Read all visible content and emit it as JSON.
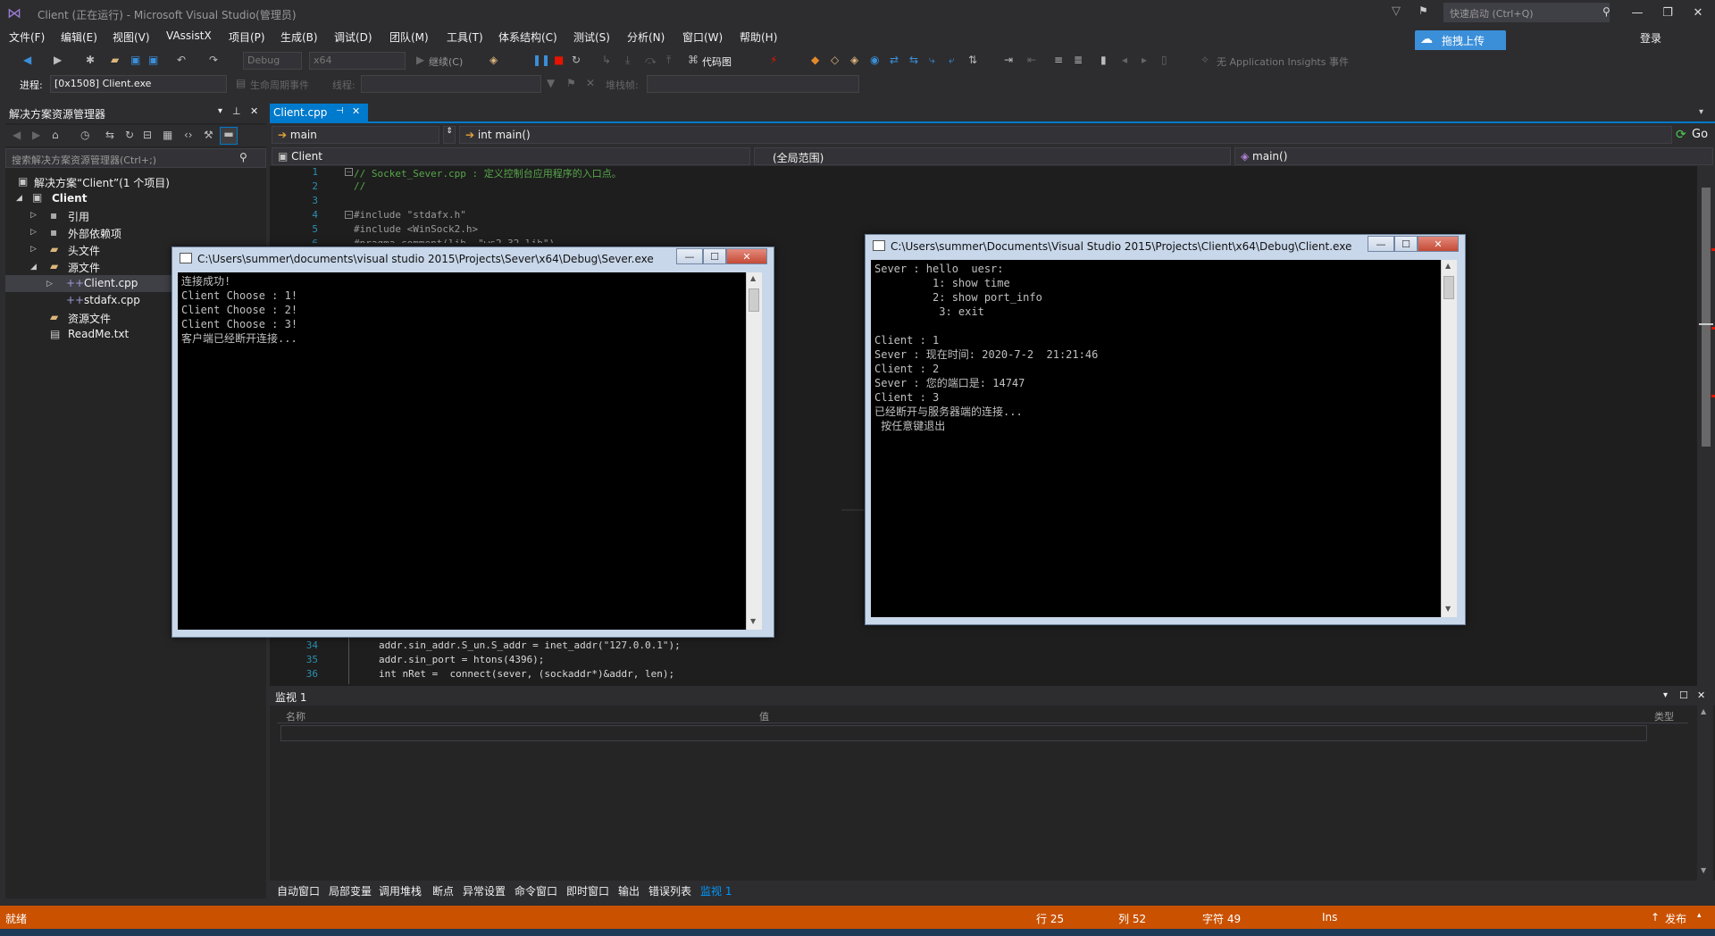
{
  "window": {
    "title": "Client (正在运行) - Microsoft Visual Studio(管理员)",
    "quick_launch_placeholder": "快速启动 (Ctrl+Q)"
  },
  "menu": [
    "文件(F)",
    "编辑(E)",
    "视图(V)",
    "VAssistX",
    "项目(P)",
    "生成(B)",
    "调试(D)",
    "团队(M)",
    "工具(T)",
    "体系结构(C)",
    "测试(S)",
    "分析(N)",
    "窗口(W)",
    "帮助(H)"
  ],
  "upload_button": "拖拽上传",
  "login": "登录",
  "toolbar": {
    "config": "Debug",
    "platform": "x64",
    "continue": "继续(C)",
    "code_map": "代码图",
    "app_insights": "无 Application Insights 事件",
    "process_label": "进程:",
    "process_value": "[0x1508] Client.exe",
    "lifecycle": "生命周期事件",
    "thread_label": "线程:",
    "stack_label": "堆栈帧:"
  },
  "solution_explorer": {
    "title": "解决方案资源管理器",
    "search_placeholder": "搜索解决方案资源管理器(Ctrl+;)",
    "solution": "解决方案“Client”(1 个项目)",
    "project": "Client",
    "items": [
      "引用",
      "外部依赖项",
      "头文件",
      "源文件",
      "Client.cpp",
      "stdafx.cpp",
      "资源文件",
      "ReadMe.txt"
    ]
  },
  "editor": {
    "tab": "Client.cpp",
    "nav_scope": "main",
    "nav_function": "int main()",
    "go": "Go",
    "project_combo": "Client",
    "scope_combo": "(全局范围)",
    "member_combo": "main()",
    "lines_top": [
      {
        "n": "1",
        "text": "// Socket_Sever.cpp : 定义控制台应用程序的入口点。"
      },
      {
        "n": "2",
        "text": "//"
      },
      {
        "n": "3",
        "text": ""
      },
      {
        "n": "4",
        "text": "#include \"stdafx.h\""
      },
      {
        "n": "5",
        "text": "#include <WinSock2.h>"
      },
      {
        "n": "6",
        "text": "#pragma comment(lib, \"ws2_32.lib\")"
      }
    ],
    "lines_bottom": [
      {
        "n": "34",
        "text": "addr.sin_addr.S_un.S_addr = inet_addr(\"127.0.0.1\");"
      },
      {
        "n": "35",
        "text": "addr.sin_port = htons(4396);"
      },
      {
        "n": "36",
        "text": "int nRet =  connect(sever, (sockaddr*)&addr, len);"
      }
    ]
  },
  "server_console": {
    "title": "C:\\Users\\summer\\documents\\visual studio 2015\\Projects\\Sever\\x64\\Debug\\Sever.exe",
    "lines": [
      "连接成功!",
      "Client Choose : 1!",
      "Client Choose : 2!",
      "Client Choose : 3!",
      "客户端已经断开连接..."
    ]
  },
  "client_console": {
    "title": "C:\\Users\\summer\\Documents\\Visual Studio 2015\\Projects\\Client\\x64\\Debug\\Client.exe",
    "lines": [
      "Sever : hello  uesr:",
      "         1: show time",
      "         2: show port_info",
      "          3: exit",
      "",
      "Client : 1",
      "Sever : 现在时间: 2020-7-2  21:21:46",
      "Client : 2",
      "Sever : 您的端口是: 14747",
      "Client : 3",
      "已经断开与服务器端的连接...",
      " 按任意键退出"
    ]
  },
  "watch": {
    "title": "监视 1",
    "col_name": "名称",
    "col_value": "值",
    "col_type": "类型"
  },
  "bottom_tabs": [
    "自动窗口",
    "局部变量",
    "调用堆栈",
    "断点",
    "异常设置",
    "命令窗口",
    "即时窗口",
    "输出",
    "错误列表",
    "监视 1"
  ],
  "status": {
    "ready": "就绪",
    "line": "行 25",
    "col": "列 52",
    "char": "字符 49",
    "mode": "Ins",
    "publish": "发布"
  },
  "colors": {
    "status_bar": "#ca5100",
    "accent": "#007acc"
  }
}
